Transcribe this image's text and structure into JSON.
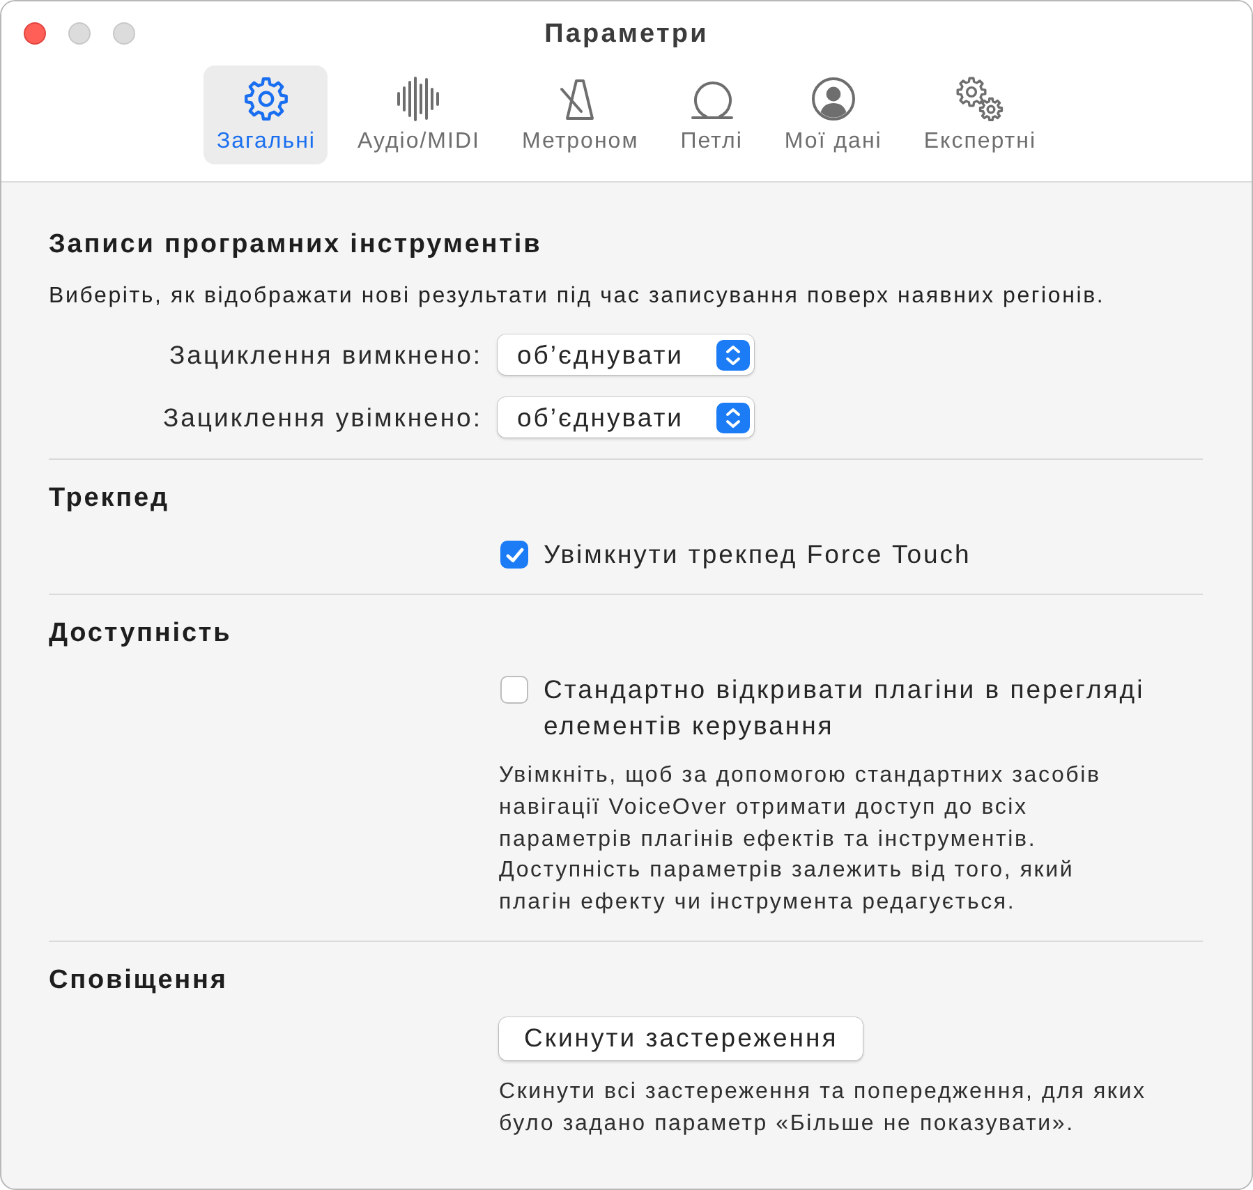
{
  "window": {
    "title": "Параметри",
    "buttons": [
      {
        "disabled": false
      },
      {
        "disabled": true
      },
      {
        "disabled": true
      }
    ]
  },
  "tabs": [
    {
      "label": "Загальні",
      "selected": true
    },
    {
      "label": "Аудіо/MIDI",
      "selected": false
    },
    {
      "label": "Метроном",
      "selected": false
    },
    {
      "label": "Петлі",
      "selected": false
    },
    {
      "label": "Мої дані",
      "selected": false
    },
    {
      "label": "Експертні",
      "selected": false
    }
  ],
  "sections": [
    {
      "heading": "Записи програмних інструментів",
      "items": [
        {
          "kind": "description",
          "text": "Виберіть, як відображати нові результати під час записування поверх наявних регіонів."
        },
        {
          "kind": "popup",
          "label": "Зациклення вимкнено:",
          "value": "об’єднувати"
        },
        {
          "kind": "popup",
          "label": "Зациклення увімкнено:",
          "value": "об’єднувати"
        }
      ]
    },
    {
      "heading": "Трекпед",
      "items": [
        {
          "kind": "checkbox",
          "label": "Увімкнути трекпед Force Touch",
          "checked": true
        }
      ]
    },
    {
      "heading": "Доступність",
      "items": [
        {
          "kind": "checkbox",
          "label": "Стандартно відкривати плагіни в перегляді елементів керування",
          "checked": false
        },
        {
          "kind": "note",
          "text": "Увімкніть, щоб за допомогою стандартних засобів навігації VoiceOver отримати доступ до всіх параметрів плагінів ефектів та інструментів. Доступність параметрів залежить від того, який плагін ефекту чи інструмента редагується."
        }
      ]
    },
    {
      "heading": "Сповіщення",
      "items": [
        {
          "kind": "button",
          "label": "Скинути застереження"
        },
        {
          "kind": "note",
          "text": "Скинути всі застереження та попередження, для яких було задано параметр «Більше не показувати»."
        }
      ]
    }
  ]
}
